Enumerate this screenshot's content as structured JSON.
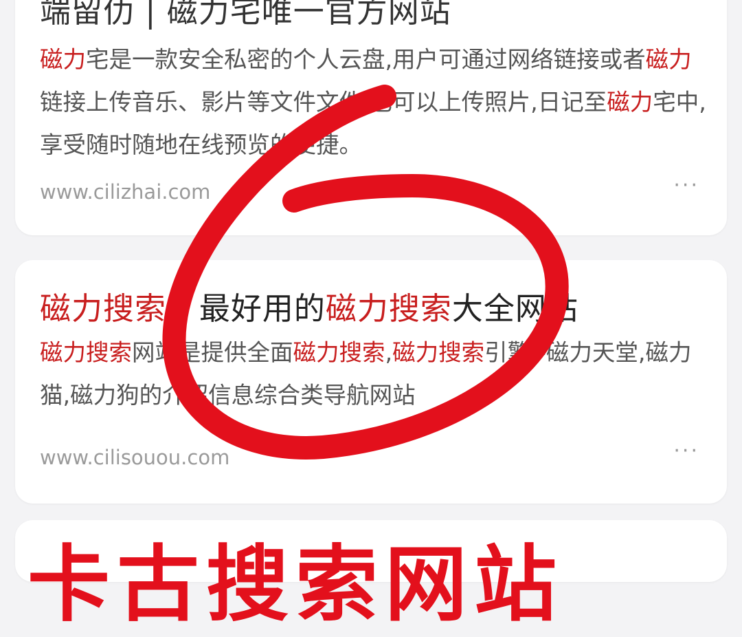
{
  "results": [
    {
      "title_parts": [
        {
          "t": "端留仂 | 磁力宅唯一官方网站",
          "hl": false
        }
      ],
      "desc_parts": [
        {
          "t": "磁力",
          "hl": true
        },
        {
          "t": "宅是一款安全私密的个人云盘,用户可通过网络链接或者",
          "hl": false
        },
        {
          "t": "磁力",
          "hl": true
        },
        {
          "t": "链接上传音乐、影片等文件文件,也可以上传照片,日记至",
          "hl": false
        },
        {
          "t": "磁力",
          "hl": true
        },
        {
          "t": "宅中,享受随时随地在线预览的便捷。",
          "hl": false
        }
      ],
      "url": "www.cilizhai.com",
      "more": "···"
    },
    {
      "title_parts": [
        {
          "t": "磁力搜索",
          "hl": true
        },
        {
          "t": " - 最好用的",
          "hl": false
        },
        {
          "t": "磁力搜索",
          "hl": true
        },
        {
          "t": "大全网站",
          "hl": false
        }
      ],
      "desc_parts": [
        {
          "t": "磁力搜索",
          "hl": true
        },
        {
          "t": "网站是提供全面",
          "hl": false
        },
        {
          "t": "磁力搜索",
          "hl": true
        },
        {
          "t": ",",
          "hl": false
        },
        {
          "t": "磁力搜索",
          "hl": true
        },
        {
          "t": "引擎 -磁力天堂,磁力猫,磁力狗的介绍信息综合类导航网站",
          "hl": false
        }
      ],
      "url": "www.cilisouou.com",
      "more": "···"
    }
  ],
  "annotation": {
    "color": "#e3101c"
  },
  "bottom_caption": "卡古搜索网站"
}
